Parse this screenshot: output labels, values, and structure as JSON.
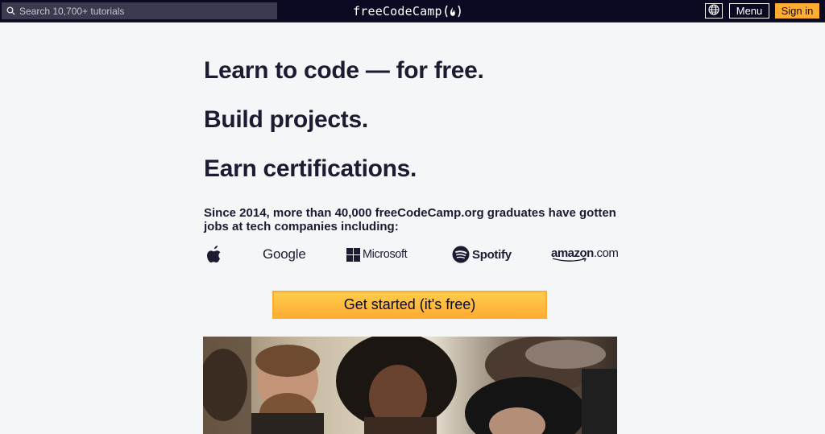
{
  "nav": {
    "search_placeholder": "Search 10,700+ tutorials",
    "brand": "freeCodeCamp",
    "brand_icon": "flame-icon",
    "language_icon": "globe-icon",
    "menu_label": "Menu",
    "signin_label": "Sign in"
  },
  "hero": {
    "headline_1": "Learn to code — for free.",
    "headline_2": "Build projects.",
    "headline_3": "Earn certifications.",
    "subtext": "Since 2014, more than 40,000 freeCodeCamp.org graduates have gotten jobs at tech companies including:",
    "companies": [
      {
        "name": "Apple",
        "icon": "apple-icon"
      },
      {
        "name": "Google"
      },
      {
        "name": "Microsoft",
        "icon": "microsoft-icon"
      },
      {
        "name": "Spotify",
        "icon": "spotify-icon"
      },
      {
        "name": "amazon",
        "suffix": ".com"
      }
    ],
    "cta_label": "Get started (it's free)"
  },
  "colors": {
    "nav_bg": "#0a0a23",
    "page_bg": "#f5f6f7",
    "text": "#1b1b32",
    "accent": "#feac32"
  }
}
